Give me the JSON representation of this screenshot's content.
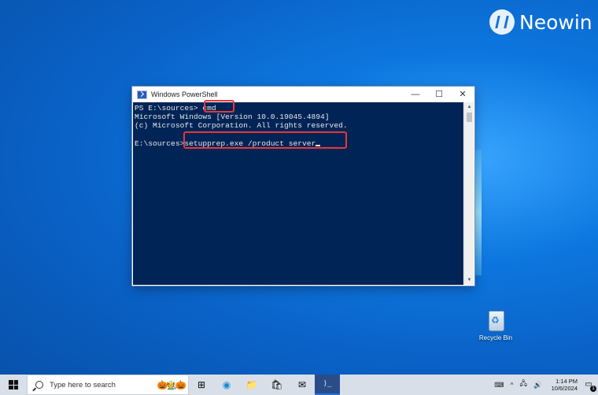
{
  "brand": {
    "name": "Neowin"
  },
  "window": {
    "title": "Windows PowerShell",
    "minimize": "—",
    "maximize": "☐",
    "close": "✕"
  },
  "console": {
    "lines": [
      "PS E:\\sources> cmd",
      "Microsoft Windows [Version 10.0.19045.4894]",
      "(c) Microsoft Corporation. All rights reserved.",
      "",
      "E:\\sources>setupprep.exe /product server"
    ]
  },
  "desktop": {
    "recycle_bin_label": "Recycle Bin"
  },
  "taskbar": {
    "search_placeholder": "Type here to search",
    "search_art": "🎃🧑‍🌾🎃",
    "apps": [
      {
        "name": "task-view-icon",
        "glyph": "⊞"
      },
      {
        "name": "edge-icon",
        "glyph": "◉"
      },
      {
        "name": "file-explorer-icon",
        "glyph": "📁"
      },
      {
        "name": "store-icon",
        "glyph": "🛍"
      },
      {
        "name": "mail-icon",
        "glyph": "✉"
      },
      {
        "name": "powershell-icon",
        "glyph": "⟩_"
      }
    ],
    "tray": {
      "keyboard": "⌨",
      "chevron": "^",
      "network": "🖧",
      "volume": "🔊",
      "time": "1:14 PM",
      "date": "10/6/2024",
      "notification_count": "1"
    }
  },
  "accent_colors": {
    "console_bg": "#012456",
    "highlight_box": "#e5383b",
    "desktop_blue": "#0a62c7"
  }
}
